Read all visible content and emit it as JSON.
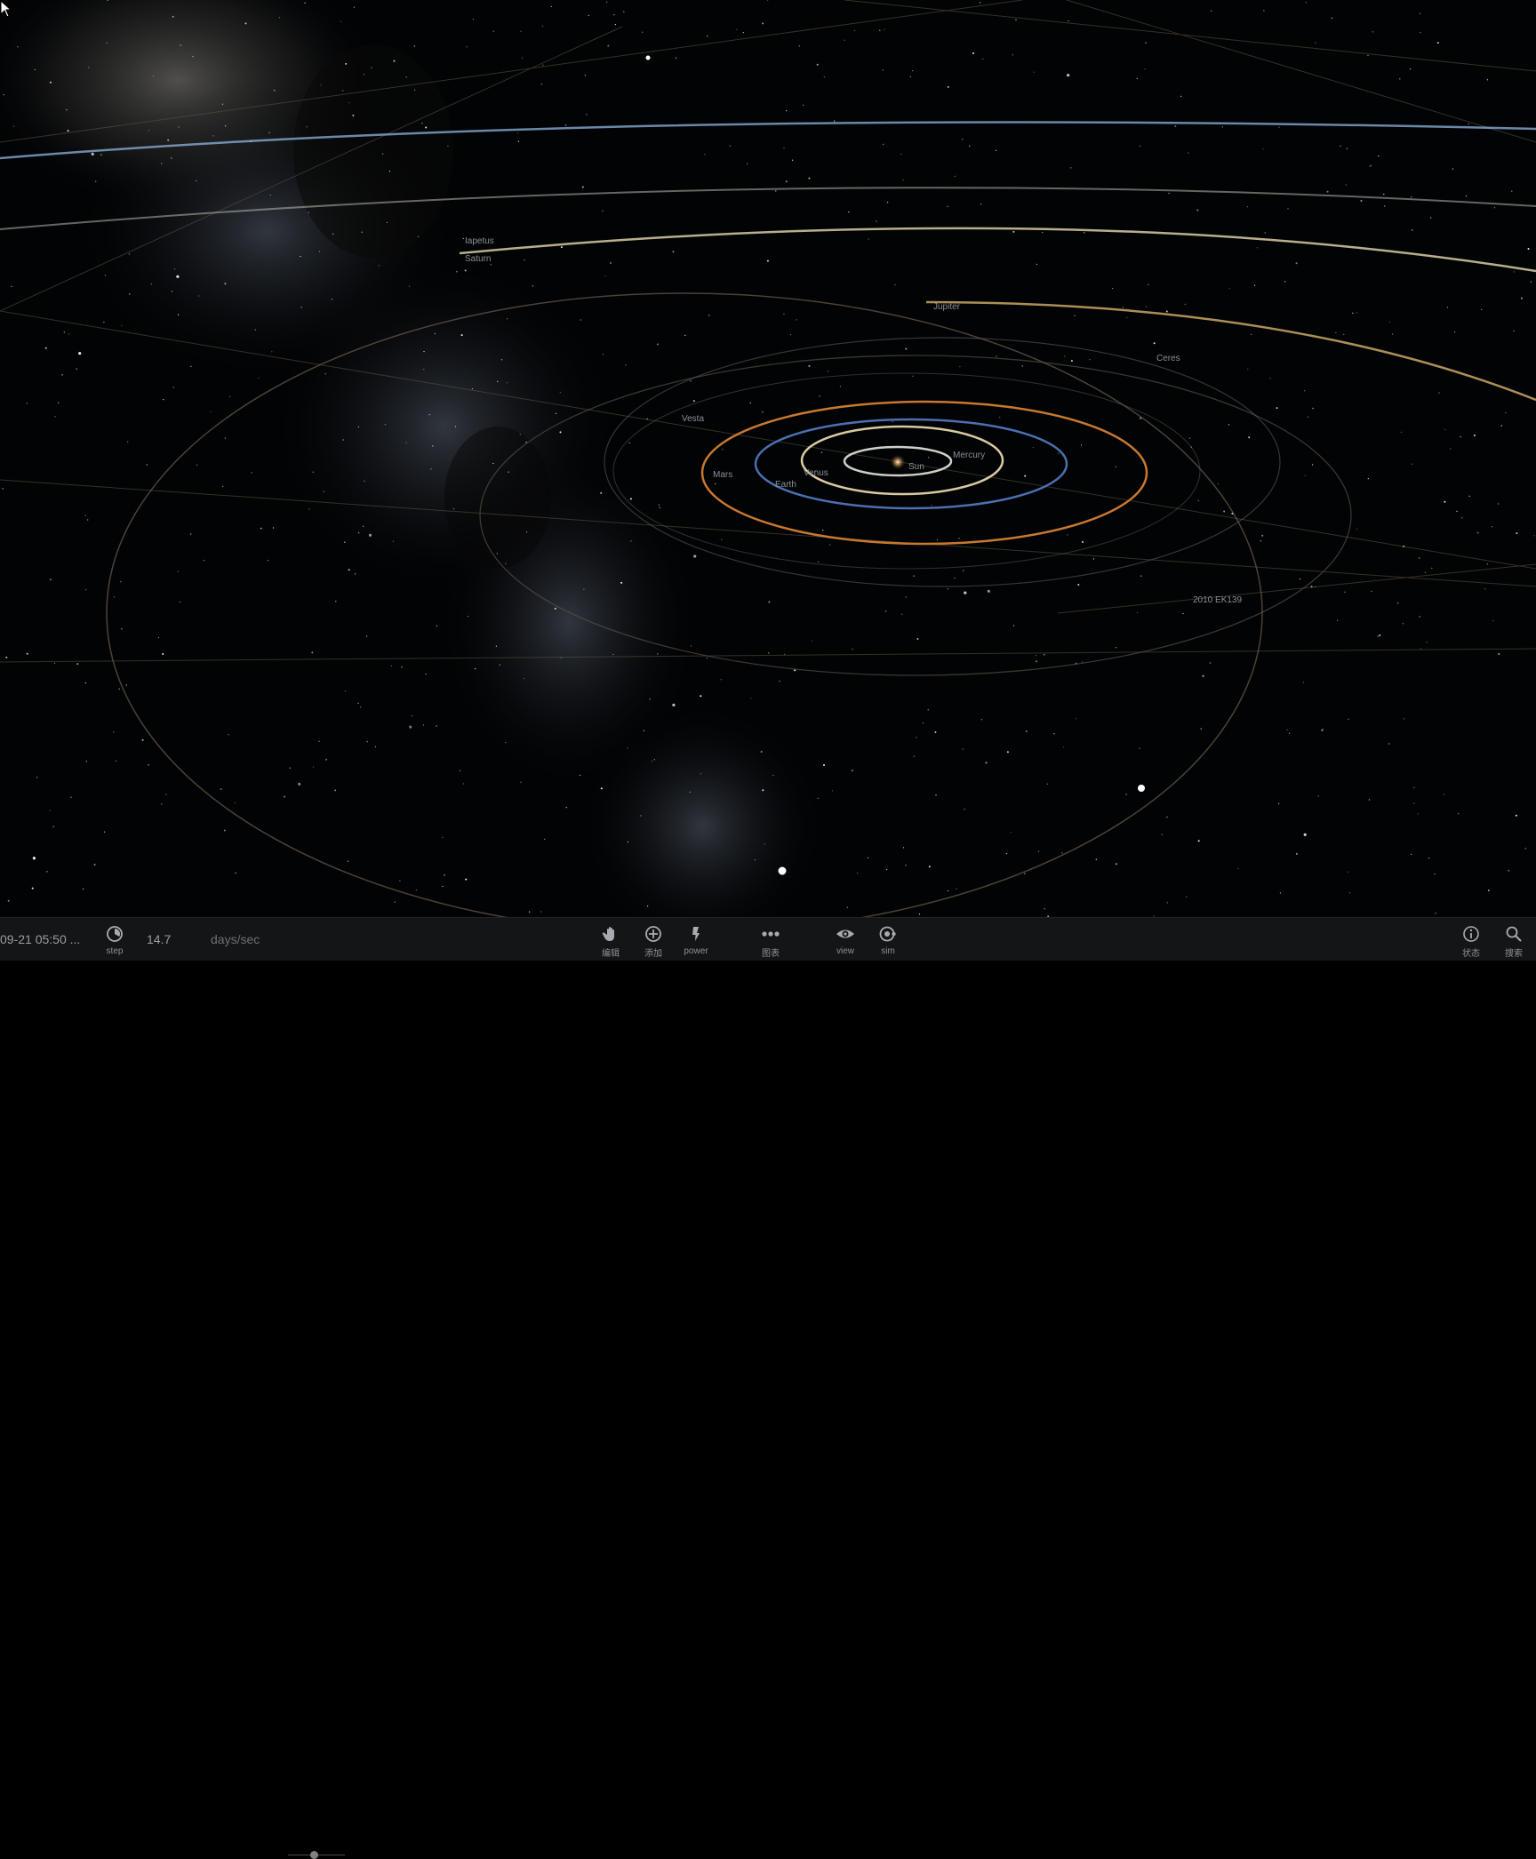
{
  "scene": {
    "labels": {
      "sun": "Sun",
      "mercury": "Mercury",
      "venus": "Venus",
      "earth": "Earth",
      "mars": "Mars",
      "vesta": "Vesta",
      "ceres": "Ceres",
      "jupiter": "Jupiter",
      "saturn": "Saturn",
      "saturn_moon": "Iapetus",
      "ek139": "2010 EK139"
    }
  },
  "toolbar": {
    "datetime": "09-21 05:50 ...",
    "step_label": "step",
    "step_value": "14.7",
    "units": "days/sec",
    "speed_level": 0.45,
    "buttons": {
      "edit": "编辑",
      "add": "添加",
      "power": "power",
      "chart": "图表",
      "view": "view",
      "sim": "sim",
      "status": "状态",
      "search": "搜索"
    }
  },
  "colors": {
    "mercury_orbit": "#cfcfc8",
    "venus_orbit": "#d8c9a0",
    "earth_orbit": "#4b6fb0",
    "mars_orbit": "#c8782f",
    "jupiter_orbit": "#c9a865",
    "saturn_orbit": "#d9cca4",
    "uranus_orbit": "#8fb4e0",
    "toolbar_bg": "#141517"
  }
}
